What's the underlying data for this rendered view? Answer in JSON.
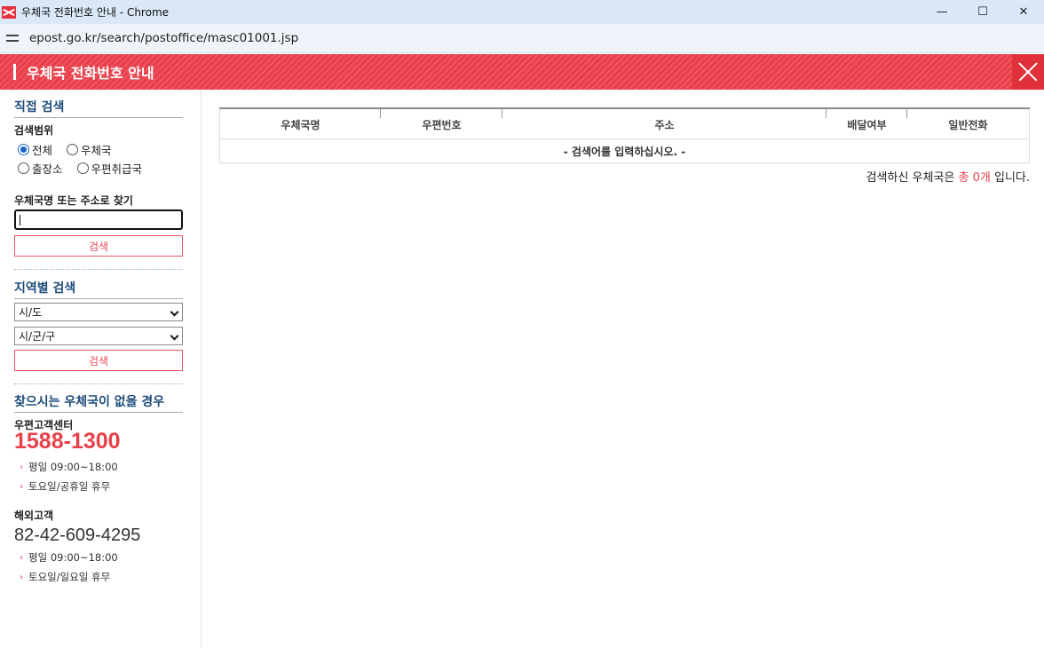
{
  "window": {
    "title": "우체국 전화번호 안내 - Chrome",
    "controls": {
      "minimize": "—",
      "maximize": "☐",
      "close": "✕"
    }
  },
  "address": {
    "url": "epost.go.kr/search/postoffice/masc01001.jsp"
  },
  "header": {
    "title": "우체국 전화번호 안내"
  },
  "direct_search": {
    "title": "직접 검색",
    "scope_label": "검색범위",
    "scopes": [
      {
        "label": "전체",
        "checked": true
      },
      {
        "label": "우체국",
        "checked": false
      },
      {
        "label": "출장소",
        "checked": false
      },
      {
        "label": "우편취급국",
        "checked": false
      }
    ],
    "find_label": "우체국명 또는 주소로 찾기",
    "input_value": "",
    "button": "검색"
  },
  "region_search": {
    "title": "지역별 검색",
    "city_select": "시/도",
    "district_select": "시/군/구",
    "button": "검색"
  },
  "not_found": {
    "title": "찾으시는 우체국이 없을 경우",
    "center_label": "우편고객센터",
    "center_phone": "1588-1300",
    "center_hours": [
      "평일 09:00~18:00",
      "토요일/공휴일 휴무"
    ],
    "overseas_label": "해외고객",
    "overseas_phone": "82-42-609-4295",
    "overseas_hours": [
      "평일 09:00~18:00",
      "토요일/일요일 휴무"
    ]
  },
  "table": {
    "columns": [
      "우체국명",
      "우편번호",
      "주소",
      "배달여부",
      "일반전화"
    ],
    "empty_message": "- 검색어를 입력하십시오. -"
  },
  "result": {
    "prefix": "검색하신 우체국은",
    "count": "총 0개",
    "suffix": "입니다."
  },
  "colors": {
    "brand_red": "#e83f4a",
    "heading_blue": "#1e4c7a",
    "radio_blue": "#1a63c9"
  }
}
